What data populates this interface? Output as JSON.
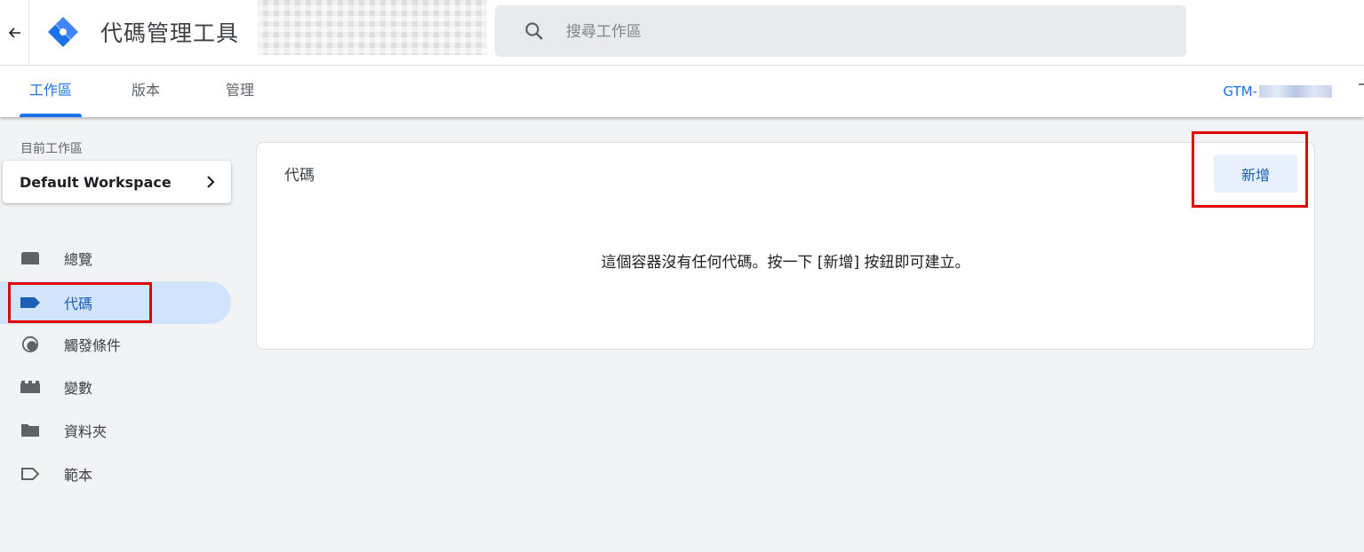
{
  "header": {
    "title": "代碼管理工具",
    "search_placeholder": "搜尋工作區",
    "container_id_prefix": "GTM-"
  },
  "tabs": [
    {
      "label": "工作區",
      "active": true
    },
    {
      "label": "版本",
      "active": false
    },
    {
      "label": "管理",
      "active": false
    }
  ],
  "sidebar": {
    "workspace_label": "目前工作區",
    "workspace_name": "Default Workspace",
    "items": [
      {
        "label": "總覽",
        "icon": "overview-icon"
      },
      {
        "label": "代碼",
        "icon": "tag-icon",
        "active": true
      },
      {
        "label": "觸發條件",
        "icon": "trigger-icon"
      },
      {
        "label": "變數",
        "icon": "variable-icon"
      },
      {
        "label": "資料夾",
        "icon": "folder-icon"
      },
      {
        "label": "範本",
        "icon": "template-icon"
      }
    ]
  },
  "main": {
    "card_title": "代碼",
    "new_button": "新增",
    "empty_message": "這個容器沒有任何代碼。按一下 [新增] 按鈕即可建立。"
  },
  "colors": {
    "accent": "#1a73e8",
    "highlight": "#e00000",
    "active_nav_bg": "#d2e3fc"
  }
}
